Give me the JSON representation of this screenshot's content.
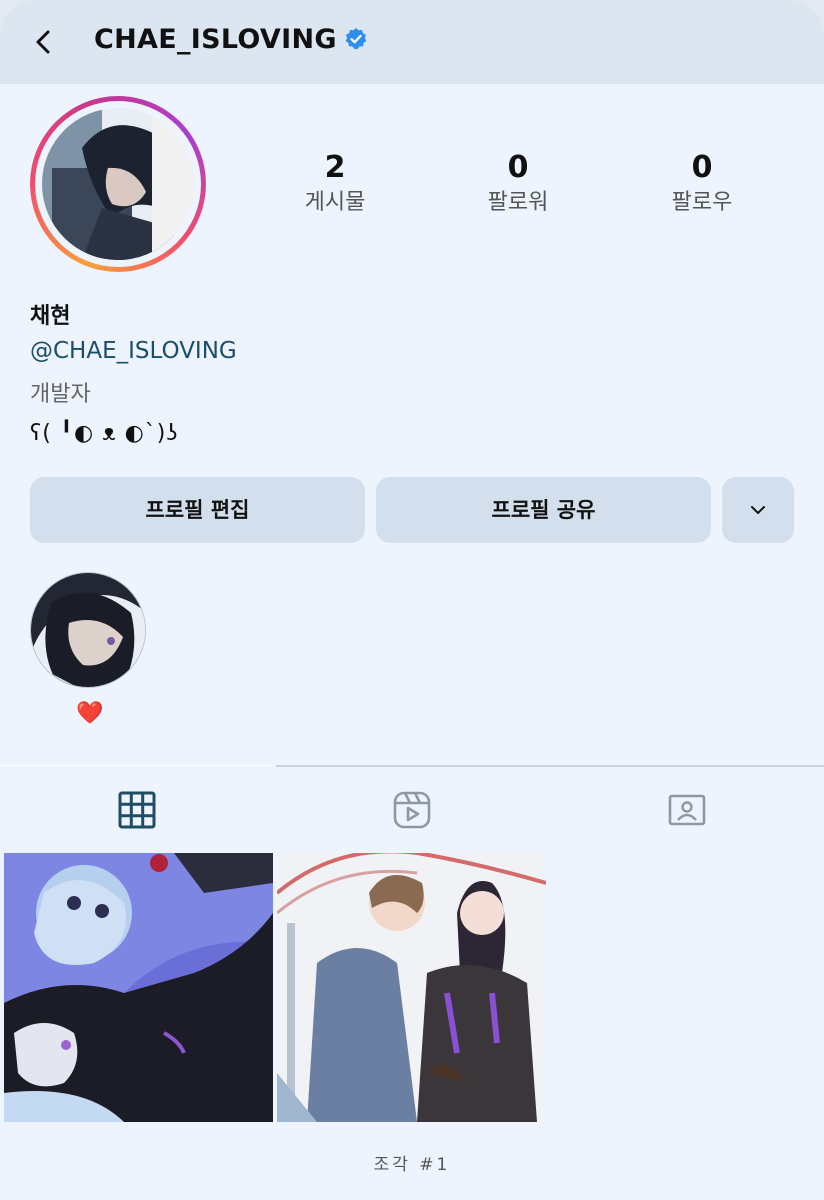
{
  "header": {
    "username": "CHAE_ISLOVING"
  },
  "stats": [
    {
      "value": "2",
      "label": "게시물"
    },
    {
      "value": "0",
      "label": "팔로워"
    },
    {
      "value": "0",
      "label": "팔로우"
    }
  ],
  "profile": {
    "name": "채현",
    "handle": "@CHAE_ISLOVING",
    "bio_line1": "개발자",
    "bio_line2": "ʕ( ╹◐ ᴥ ◐`)ʖ"
  },
  "buttons": {
    "edit": "프로필 편집",
    "share": "프로필 공유"
  },
  "highlight": {
    "label": "❤️"
  },
  "tabs": [
    "grid-icon",
    "reels-icon",
    "tagged-icon"
  ],
  "footer": {
    "caption": "조각 #1"
  },
  "colors": {
    "background": "#edf4fd",
    "topbar": "#dce6f1",
    "button": "#d3dfec",
    "handle": "#1b4e6b",
    "verified": "#2f8ff0",
    "active_tab": "#1f4d63"
  }
}
